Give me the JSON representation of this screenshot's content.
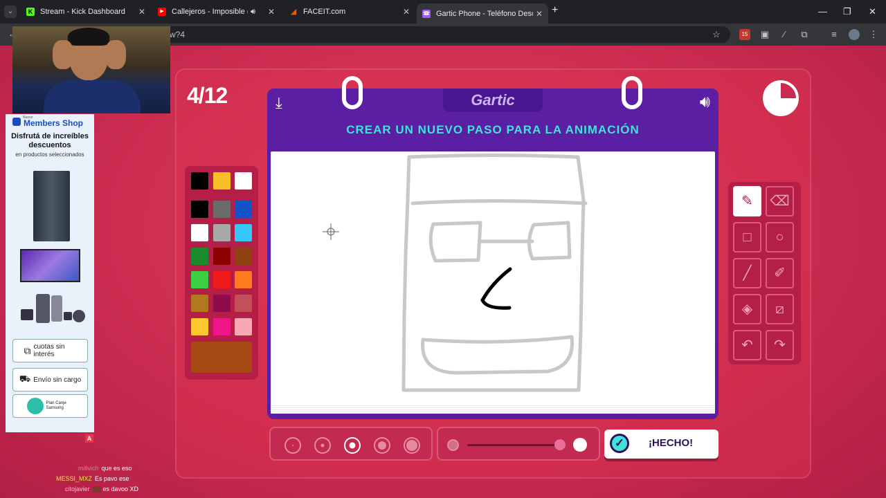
{
  "browser": {
    "tabs": [
      {
        "title": "Stream - Kick Dashboard",
        "fav_color": "#53fc18",
        "fav_glyph": "K"
      },
      {
        "title": "Callejeros - Imposible (En V",
        "fav_color": "#ff0000",
        "fav_glyph": "▶"
      },
      {
        "title": "FACEIT.com",
        "fav_color": "#ff5500",
        "fav_glyph": "◢"
      },
      {
        "title": "Gartic Phone - Teléfono Descor",
        "fav_color": "#a05cf0",
        "fav_glyph": "☎"
      }
    ],
    "url_tail": "w?4",
    "ext_badge": "15"
  },
  "game": {
    "counter": "4/12",
    "logo": "Gartic",
    "prompt": "CREAR UN NUEVO PASO PARA LA ANIMACIÓN",
    "done_label": "¡HECHO!",
    "palette": [
      "#000000",
      "#f6bf26",
      "#ffffff",
      "#000000",
      "#6b6b6b",
      "#1353c8",
      "#ffffff",
      "#a8a8a8",
      "#38c6f4",
      "#1a8a2e",
      "#8c0000",
      "#8f4111",
      "#3ad041",
      "#f01a1a",
      "#ff7a1f",
      "#b27a20",
      "#8f0c4a",
      "#c24f59",
      "#fdc82f",
      "#f0148a",
      "#f6a8b4"
    ],
    "selected_color": "#a64812",
    "tools": [
      "pencil-icon",
      "eraser-icon",
      "rectangle-icon",
      "ellipse-icon",
      "line-icon",
      "eyedropper-icon",
      "fill-icon",
      "clear-icon",
      "undo-icon",
      "redo-icon"
    ],
    "selected_tool": "pencil-icon"
  },
  "ad": {
    "brand_small": "Nuevo",
    "brand": "Members Shop",
    "headline": "Disfrutá de increíbles descuentos",
    "sub": "en productos seleccionados",
    "btn1": "cuotas sin interés",
    "btn2": "Envío sin cargo",
    "btn3": "Plan Canje Samsung"
  },
  "chat": [
    {
      "user": "millvich",
      "user_color": "#b58f9a",
      "text": "que es eso"
    },
    {
      "user": "MESSI_MXZ",
      "user_color": "#d6f03a",
      "text": "Es pavo ese"
    },
    {
      "user": "citojavier",
      "user_color": "#e8c8d0",
      "text": "es davoo XD"
    }
  ]
}
